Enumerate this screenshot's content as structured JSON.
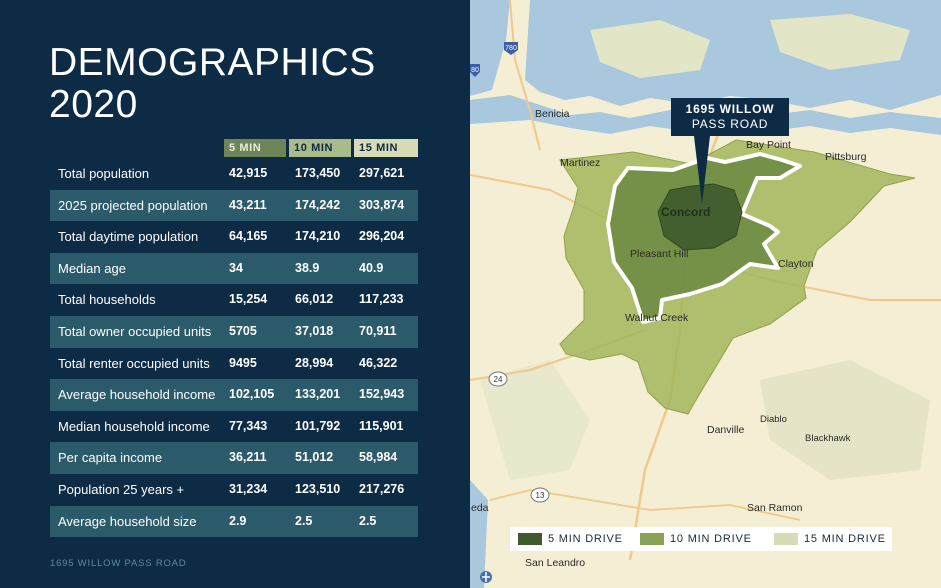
{
  "title_lines": [
    "DEMOGRAPHICS",
    "2020"
  ],
  "columns": [
    "5 MIN",
    "10 MIN",
    "15 MIN"
  ],
  "rows": [
    {
      "label": "Total population",
      "values": [
        "42,915",
        "173,450",
        "297,621"
      ]
    },
    {
      "label": "2025 projected population",
      "values": [
        "43,211",
        "174,242",
        "303,874"
      ]
    },
    {
      "label": "Total daytime population",
      "values": [
        "64,165",
        "174,210",
        "296,204"
      ]
    },
    {
      "label": "Median age",
      "values": [
        "34",
        "38.9",
        "40.9"
      ]
    },
    {
      "label": "Total households",
      "values": [
        "15,254",
        "66,012",
        "117,233"
      ]
    },
    {
      "label": "Total owner occupied units",
      "values": [
        "5705",
        "37,018",
        "70,911"
      ]
    },
    {
      "label": "Total renter occupied units",
      "values": [
        "9495",
        "28,994",
        "46,322"
      ]
    },
    {
      "label": "Average household income",
      "values": [
        "102,105",
        "133,201",
        "152,943"
      ]
    },
    {
      "label": "Median household income",
      "values": [
        "77,343",
        "101,792",
        "115,901"
      ]
    },
    {
      "label": "Per capita income",
      "values": [
        "36,211",
        "51,012",
        "58,984"
      ]
    },
    {
      "label": "Population 25 years +",
      "values": [
        "31,234",
        "123,510",
        "217,276"
      ]
    },
    {
      "label": "Average household size",
      "values": [
        "2.9",
        "2.5",
        "2.5"
      ]
    }
  ],
  "footer": "1695 WILLOW PASS ROAD",
  "map": {
    "callout_lines": [
      "1695 WILLOW",
      "PASS ROAD"
    ],
    "places": {
      "benicia": "Benicia",
      "martinez": "Martinez",
      "pittsburg": "Pittsburg",
      "bay_point": "Bay Point",
      "concord": "Concord",
      "pleasant_hill": "Pleasant Hill",
      "clayton": "Clayton",
      "walnut_creek": "Walnut Creek",
      "danville": "Danville",
      "diablo": "Diablo",
      "blackhawk": "Blackhawk",
      "san_ramon": "San Ramon",
      "san_leandro": "San Leandro",
      "alameda": "eda"
    },
    "shields": {
      "i780": "780",
      "i80": "80",
      "r24": "24",
      "r13": "13"
    },
    "legend": [
      "5 MIN DRIVE",
      "10 MIN DRIVE",
      "15 MIN DRIVE"
    ],
    "colors": {
      "zone_5": "#3f5a2c",
      "zone_10": "#6f8c43",
      "zone_15": "#a3b65c",
      "water": "#a9c8dd",
      "land": "#f4eed5",
      "panel": "#0d2b45",
      "row_alt": "#2b5a6b"
    }
  }
}
